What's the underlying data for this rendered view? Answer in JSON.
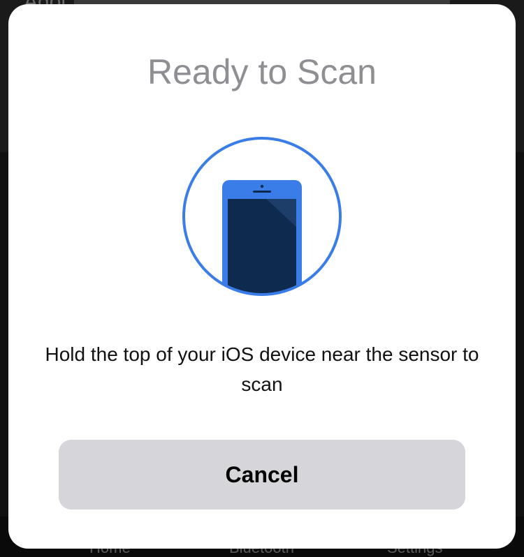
{
  "background": {
    "app_title": "Adol",
    "tabs": [
      "Home",
      "Bluetooth",
      "Settings"
    ]
  },
  "sheet": {
    "title": "Ready to Scan",
    "message": "Hold the top of your iOS device near the sensor to scan",
    "cancel_label": "Cancel",
    "graphic_icon": "phone-scan-icon"
  },
  "colors": {
    "accent_blue": "#3b7de8",
    "phone_screen": "#0e2a4e",
    "title_gray": "#8e8e93",
    "button_bg": "#d5d5da"
  }
}
